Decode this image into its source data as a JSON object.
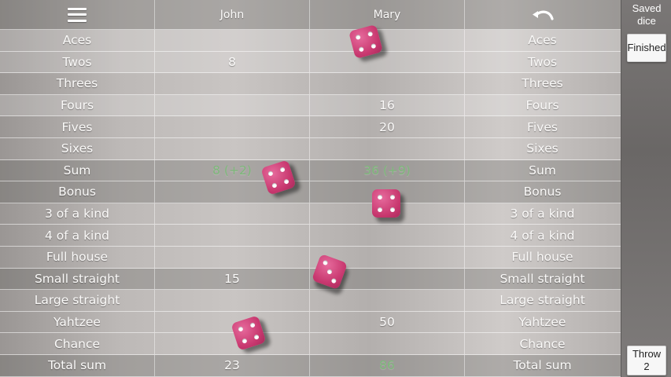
{
  "header": {
    "menu_icon": "hamburger-menu-icon",
    "players": [
      "John",
      "Mary"
    ],
    "undo_icon": "undo-arrow-icon"
  },
  "rows": [
    {
      "label": "Aces",
      "john": "",
      "mary": "",
      "label2": "Aces"
    },
    {
      "label": "Twos",
      "john": "8",
      "mary": "",
      "label2": "Twos"
    },
    {
      "label": "Threes",
      "john": "",
      "mary": "",
      "label2": "Threes"
    },
    {
      "label": "Fours",
      "john": "",
      "mary": "16",
      "label2": "Fours"
    },
    {
      "label": "Fives",
      "john": "",
      "mary": "20",
      "label2": "Fives"
    },
    {
      "label": "Sixes",
      "john": "",
      "mary": "",
      "label2": "Sixes"
    },
    {
      "label": "Sum",
      "john": "8 (+2)",
      "mary": "36 (+9)",
      "label2": "Sum"
    },
    {
      "label": "Bonus",
      "john": "",
      "mary": "",
      "label2": "Bonus"
    },
    {
      "label": "3 of a kind",
      "john": "",
      "mary": "",
      "label2": "3 of a kind"
    },
    {
      "label": "4 of a kind",
      "john": "",
      "mary": "",
      "label2": "4 of a kind"
    },
    {
      "label": "Full house",
      "john": "",
      "mary": "",
      "label2": "Full house"
    },
    {
      "label": "Small straight",
      "john": "15",
      "mary": "",
      "label2": "Small straight"
    },
    {
      "label": "Large straight",
      "john": "",
      "mary": "",
      "label2": "Large straight"
    },
    {
      "label": "Yahtzee",
      "john": "",
      "mary": "50",
      "label2": "Yahtzee"
    },
    {
      "label": "Chance",
      "john": "",
      "mary": "",
      "label2": "Chance"
    },
    {
      "label": "Total sum",
      "john": "23",
      "mary": "86",
      "label2": "Total sum"
    }
  ],
  "colors": {
    "highlight_green": "#7db87a",
    "dice": "#c8386f"
  },
  "sidebar": {
    "title_line1": "Saved",
    "title_line2": "dice",
    "finished_label": "Finished",
    "throw_label": "Throw",
    "throw_count": "2"
  },
  "dice": [
    {
      "name": "die-1",
      "value": 4
    },
    {
      "name": "die-2",
      "value": 4
    },
    {
      "name": "die-3",
      "value": 4
    },
    {
      "name": "die-4",
      "value": 3
    },
    {
      "name": "die-5",
      "value": 4
    }
  ]
}
